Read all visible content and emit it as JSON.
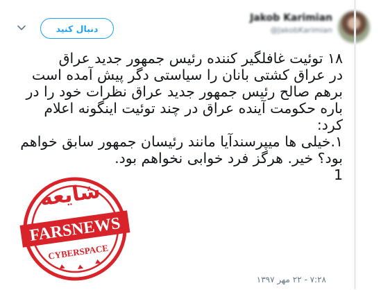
{
  "header": {
    "display_name": "Jakob Karimian",
    "handle": "@JakobKarimian",
    "follow_label": "دنبال کنید"
  },
  "tweet": {
    "lines": [
      "۱۸ توئیت غافلگیر کننده رئیس جمهور جدید عراق",
      "در عراق کشتی بانان را سیاستی دگر پیش آمده است",
      "برهم صالح رئیس جمهور جدید عراق نظرات خود را در باره حکومت آینده عراق در چند توئیت اینگونه اعلام کرد:",
      "۱.خیلی ها میپرسندآیا مانند رئیسان جمهور سابق خواهم بود؟ خیر. هرگز فرد خوابی نخواهم بود.",
      "1"
    ],
    "timestamp": "۷:۲۸ - ۲۲ مهر ۱۳۹۷"
  },
  "stamp": {
    "top_text": "شایعه",
    "main_text": "FARSNEWS",
    "sub_text": "CYBERSPACE"
  },
  "colors": {
    "accent": "#1da1f2",
    "stamp_red": "#d8232a",
    "text": "#14171a",
    "muted": "#657786"
  },
  "icons": {
    "menu": "chevron-down-icon"
  }
}
